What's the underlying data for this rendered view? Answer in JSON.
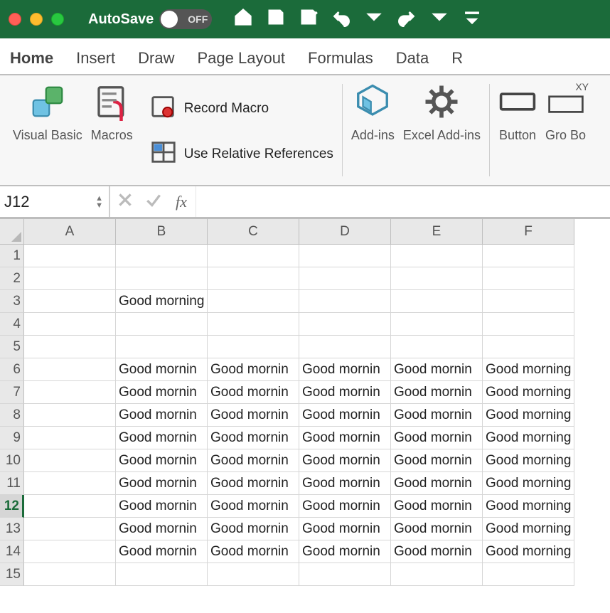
{
  "titlebar": {
    "autosave_label": "AutoSave",
    "toggle_text": "OFF"
  },
  "tabs": [
    "Home",
    "Insert",
    "Draw",
    "Page Layout",
    "Formulas",
    "Data",
    "R"
  ],
  "ribbon": {
    "visual_basic": "Visual Basic",
    "macros": "Macros",
    "record_macro": "Record Macro",
    "use_relative": "Use Relative References",
    "addins": "Add-ins",
    "excel_addins": "Excel Add-ins",
    "button": "Button",
    "group_box": "Gro Bo",
    "xy": "XY"
  },
  "formula": {
    "namebox": "J12",
    "fx_label": "fx",
    "value": ""
  },
  "grid": {
    "columns": [
      "A",
      "B",
      "C",
      "D",
      "E",
      "F"
    ],
    "rows": 15,
    "selected_row": 12,
    "cells": {
      "B3": "Good morning",
      "B6": "Good mornin",
      "C6": "Good mornin",
      "D6": "Good mornin",
      "E6": "Good mornin",
      "F6": "Good morning",
      "B7": "Good mornin",
      "C7": "Good mornin",
      "D7": "Good mornin",
      "E7": "Good mornin",
      "F7": "Good morning",
      "B8": "Good mornin",
      "C8": "Good mornin",
      "D8": "Good mornin",
      "E8": "Good mornin",
      "F8": "Good morning",
      "B9": "Good mornin",
      "C9": "Good mornin",
      "D9": "Good mornin",
      "E9": "Good mornin",
      "F9": "Good morning",
      "B10": "Good mornin",
      "C10": "Good mornin",
      "D10": "Good mornin",
      "E10": "Good mornin",
      "F10": "Good morning",
      "B11": "Good mornin",
      "C11": "Good mornin",
      "D11": "Good mornin",
      "E11": "Good mornin",
      "F11": "Good morning",
      "B12": "Good mornin",
      "C12": "Good mornin",
      "D12": "Good mornin",
      "E12": "Good mornin",
      "F12": "Good morning",
      "B13": "Good mornin",
      "C13": "Good mornin",
      "D13": "Good mornin",
      "E13": "Good mornin",
      "F13": "Good morning",
      "B14": "Good mornin",
      "C14": "Good mornin",
      "D14": "Good mornin",
      "E14": "Good mornin",
      "F14": "Good morning"
    }
  }
}
